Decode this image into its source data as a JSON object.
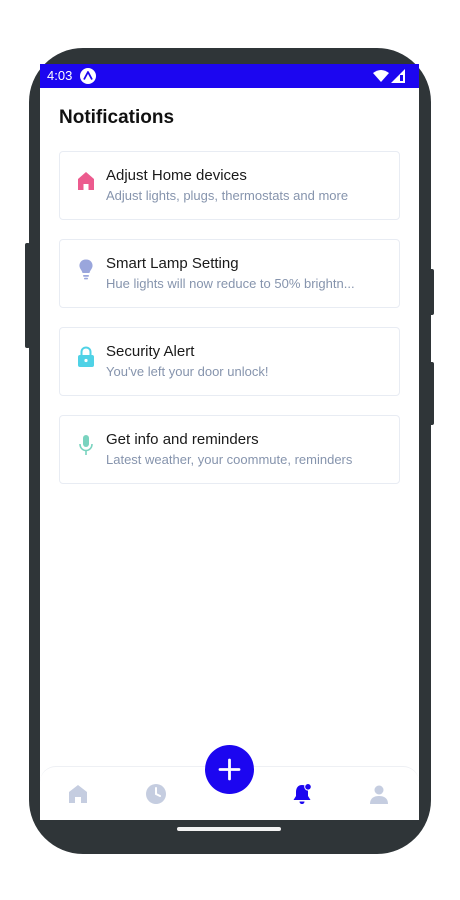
{
  "status_bar": {
    "time": "4:03",
    "app_icon": "expo-icon",
    "right_icons": [
      "wifi-icon",
      "cellular-signal-icon"
    ]
  },
  "page": {
    "title": "Notifications"
  },
  "notifications": [
    {
      "icon": "home-icon",
      "icon_color": "#ec5b8e",
      "title": "Adjust Home devices",
      "subtitle": "Adjust lights, plugs, thermostats and more"
    },
    {
      "icon": "lightbulb-icon",
      "icon_color": "#9aa6dc",
      "title": "Smart Lamp Setting",
      "subtitle": "Hue lights will now reduce to 50% brightn..."
    },
    {
      "icon": "lock-icon",
      "icon_color": "#4fd2e6",
      "title": "Security Alert",
      "subtitle": "You've left your door unlock!"
    },
    {
      "icon": "microphone-icon",
      "icon_color": "#79d3bf",
      "title": "Get info and reminders",
      "subtitle": "Latest weather, your coommute, reminders"
    }
  ],
  "tab_bar": {
    "tabs": [
      {
        "name": "home-icon",
        "active": false
      },
      {
        "name": "clock-icon",
        "active": false
      },
      {
        "name": "bell-icon",
        "active": true,
        "badge": true
      },
      {
        "name": "user-icon",
        "active": false
      }
    ],
    "fab_icon": "plus-icon"
  },
  "colors": {
    "accent": "#1c06f0",
    "inactive_tab": "#c5cde0",
    "subtitle": "#8694ad"
  }
}
